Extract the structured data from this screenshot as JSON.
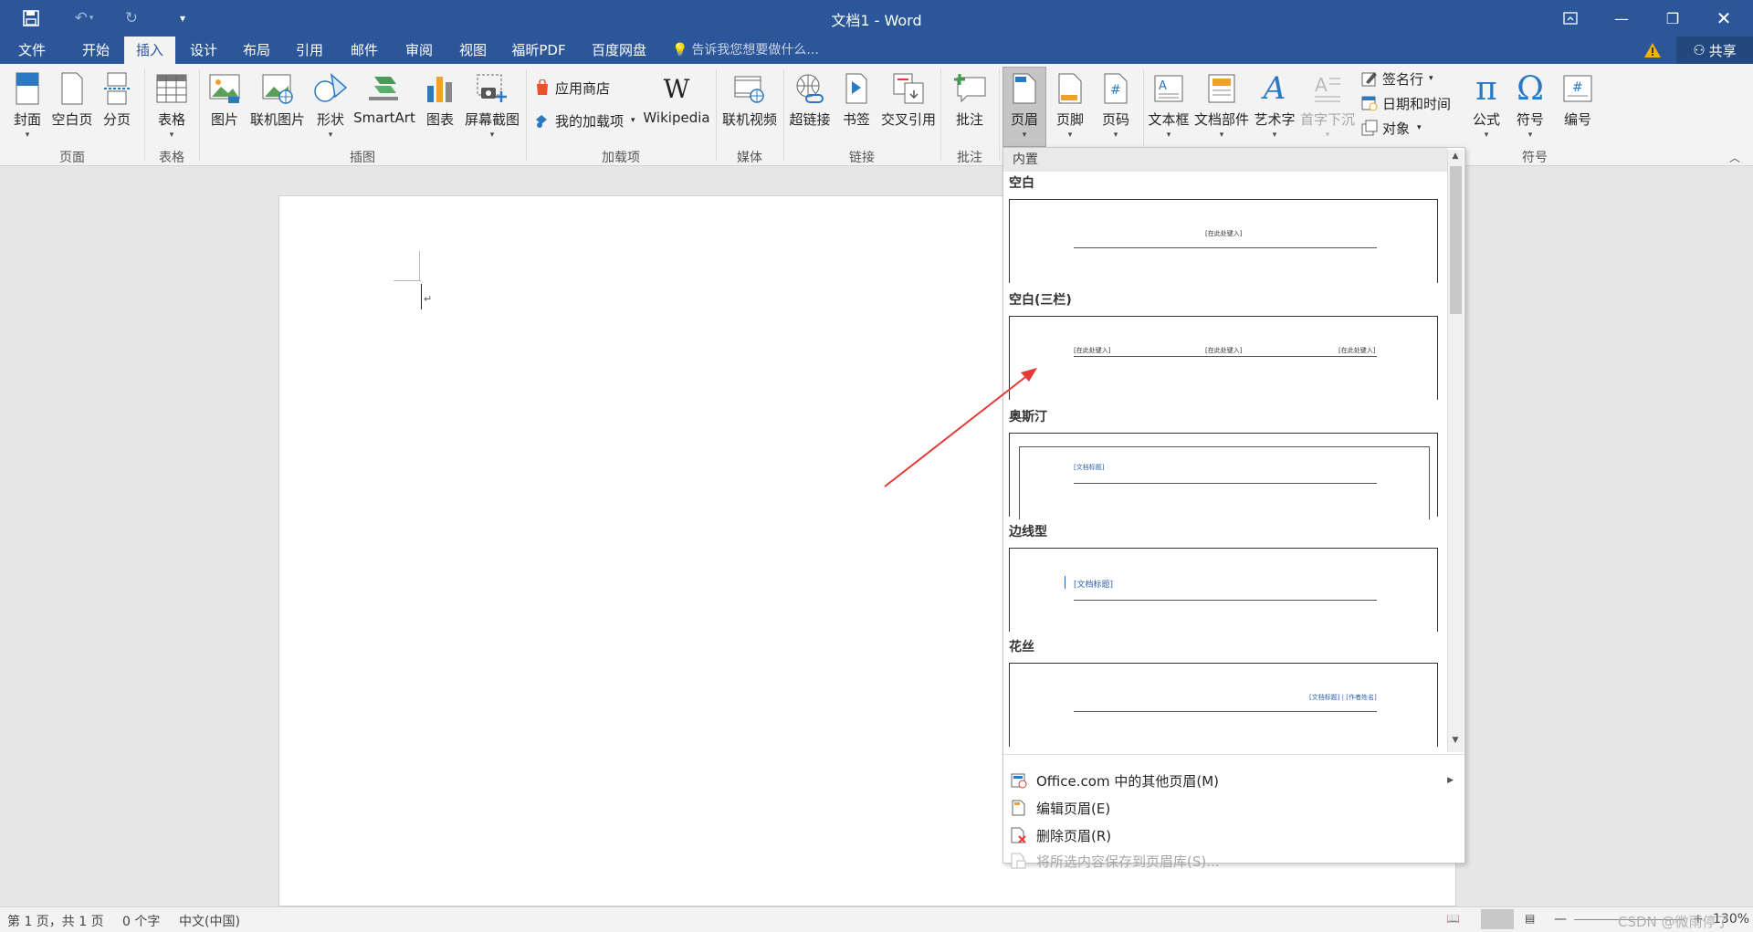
{
  "window": {
    "title": "文档1 - Word"
  },
  "tabs": [
    "文件",
    "开始",
    "插入",
    "设计",
    "布局",
    "引用",
    "邮件",
    "审阅",
    "视图",
    "福昕PDF",
    "百度网盘"
  ],
  "active_tab": "插入",
  "tell_me": "告诉我您想要做什么...",
  "share": "共享",
  "ribbon": {
    "pages": {
      "label": "页面",
      "cover": "封面",
      "blank": "空白页",
      "break": "分页"
    },
    "tables": {
      "label": "表格",
      "table": "表格"
    },
    "illustrations": {
      "label": "插图",
      "pictures": "图片",
      "online_pictures": "联机图片",
      "shapes": "形状",
      "smartart": "SmartArt",
      "chart": "图表",
      "screenshot": "屏幕截图"
    },
    "addins": {
      "label": "加载项",
      "store": "应用商店",
      "my_addins": "我的加载项",
      "wikipedia": "Wikipedia"
    },
    "media": {
      "label": "媒体",
      "online_video": "联机视频"
    },
    "links": {
      "label": "链接",
      "hyperlink": "超链接",
      "bookmark": "书签",
      "cross_ref": "交叉引用"
    },
    "comments": {
      "label": "批注",
      "comment": "批注"
    },
    "header_footer": {
      "header": "页眉",
      "footer": "页脚",
      "page_number": "页码"
    },
    "text": {
      "textbox": "文本框",
      "quick_parts": "文档部件",
      "wordart": "艺术字",
      "dropcap": "首字下沉",
      "signature": "签名行",
      "datetime": "日期和时间",
      "object": "对象"
    },
    "symbols": {
      "label": "符号",
      "equation": "公式",
      "symbol": "符号",
      "number": "编号"
    }
  },
  "gallery": {
    "section": "内置",
    "items": [
      {
        "name": "空白",
        "placeholders": [
          "[在此处键入]"
        ]
      },
      {
        "name": "空白(三栏)",
        "placeholders": [
          "[在此处键入]",
          "[在此处键入]",
          "[在此处键入]"
        ]
      },
      {
        "name": "奥斯汀",
        "placeholders": [
          "[文档标题]"
        ]
      },
      {
        "name": "边线型",
        "placeholders": [
          "[文档标题]"
        ]
      },
      {
        "name": "花丝",
        "placeholders": [
          "[文档标题] | [作者姓名]"
        ]
      }
    ],
    "menu": [
      {
        "label": "Office.com 中的其他页眉(M)",
        "enabled": true
      },
      {
        "label": "编辑页眉(E)",
        "enabled": true
      },
      {
        "label": "删除页眉(R)",
        "enabled": true
      },
      {
        "label": "将所选内容保存到页眉库(S)...",
        "enabled": false
      }
    ]
  },
  "status": {
    "page": "第 1 页，共 1 页",
    "words": "0 个字",
    "language": "中文(中国)",
    "zoom": "130%",
    "watermark": "CSDN @微雨停了"
  },
  "colors": {
    "title_blue": "#2b579a",
    "annotation_red": "#e53935"
  }
}
